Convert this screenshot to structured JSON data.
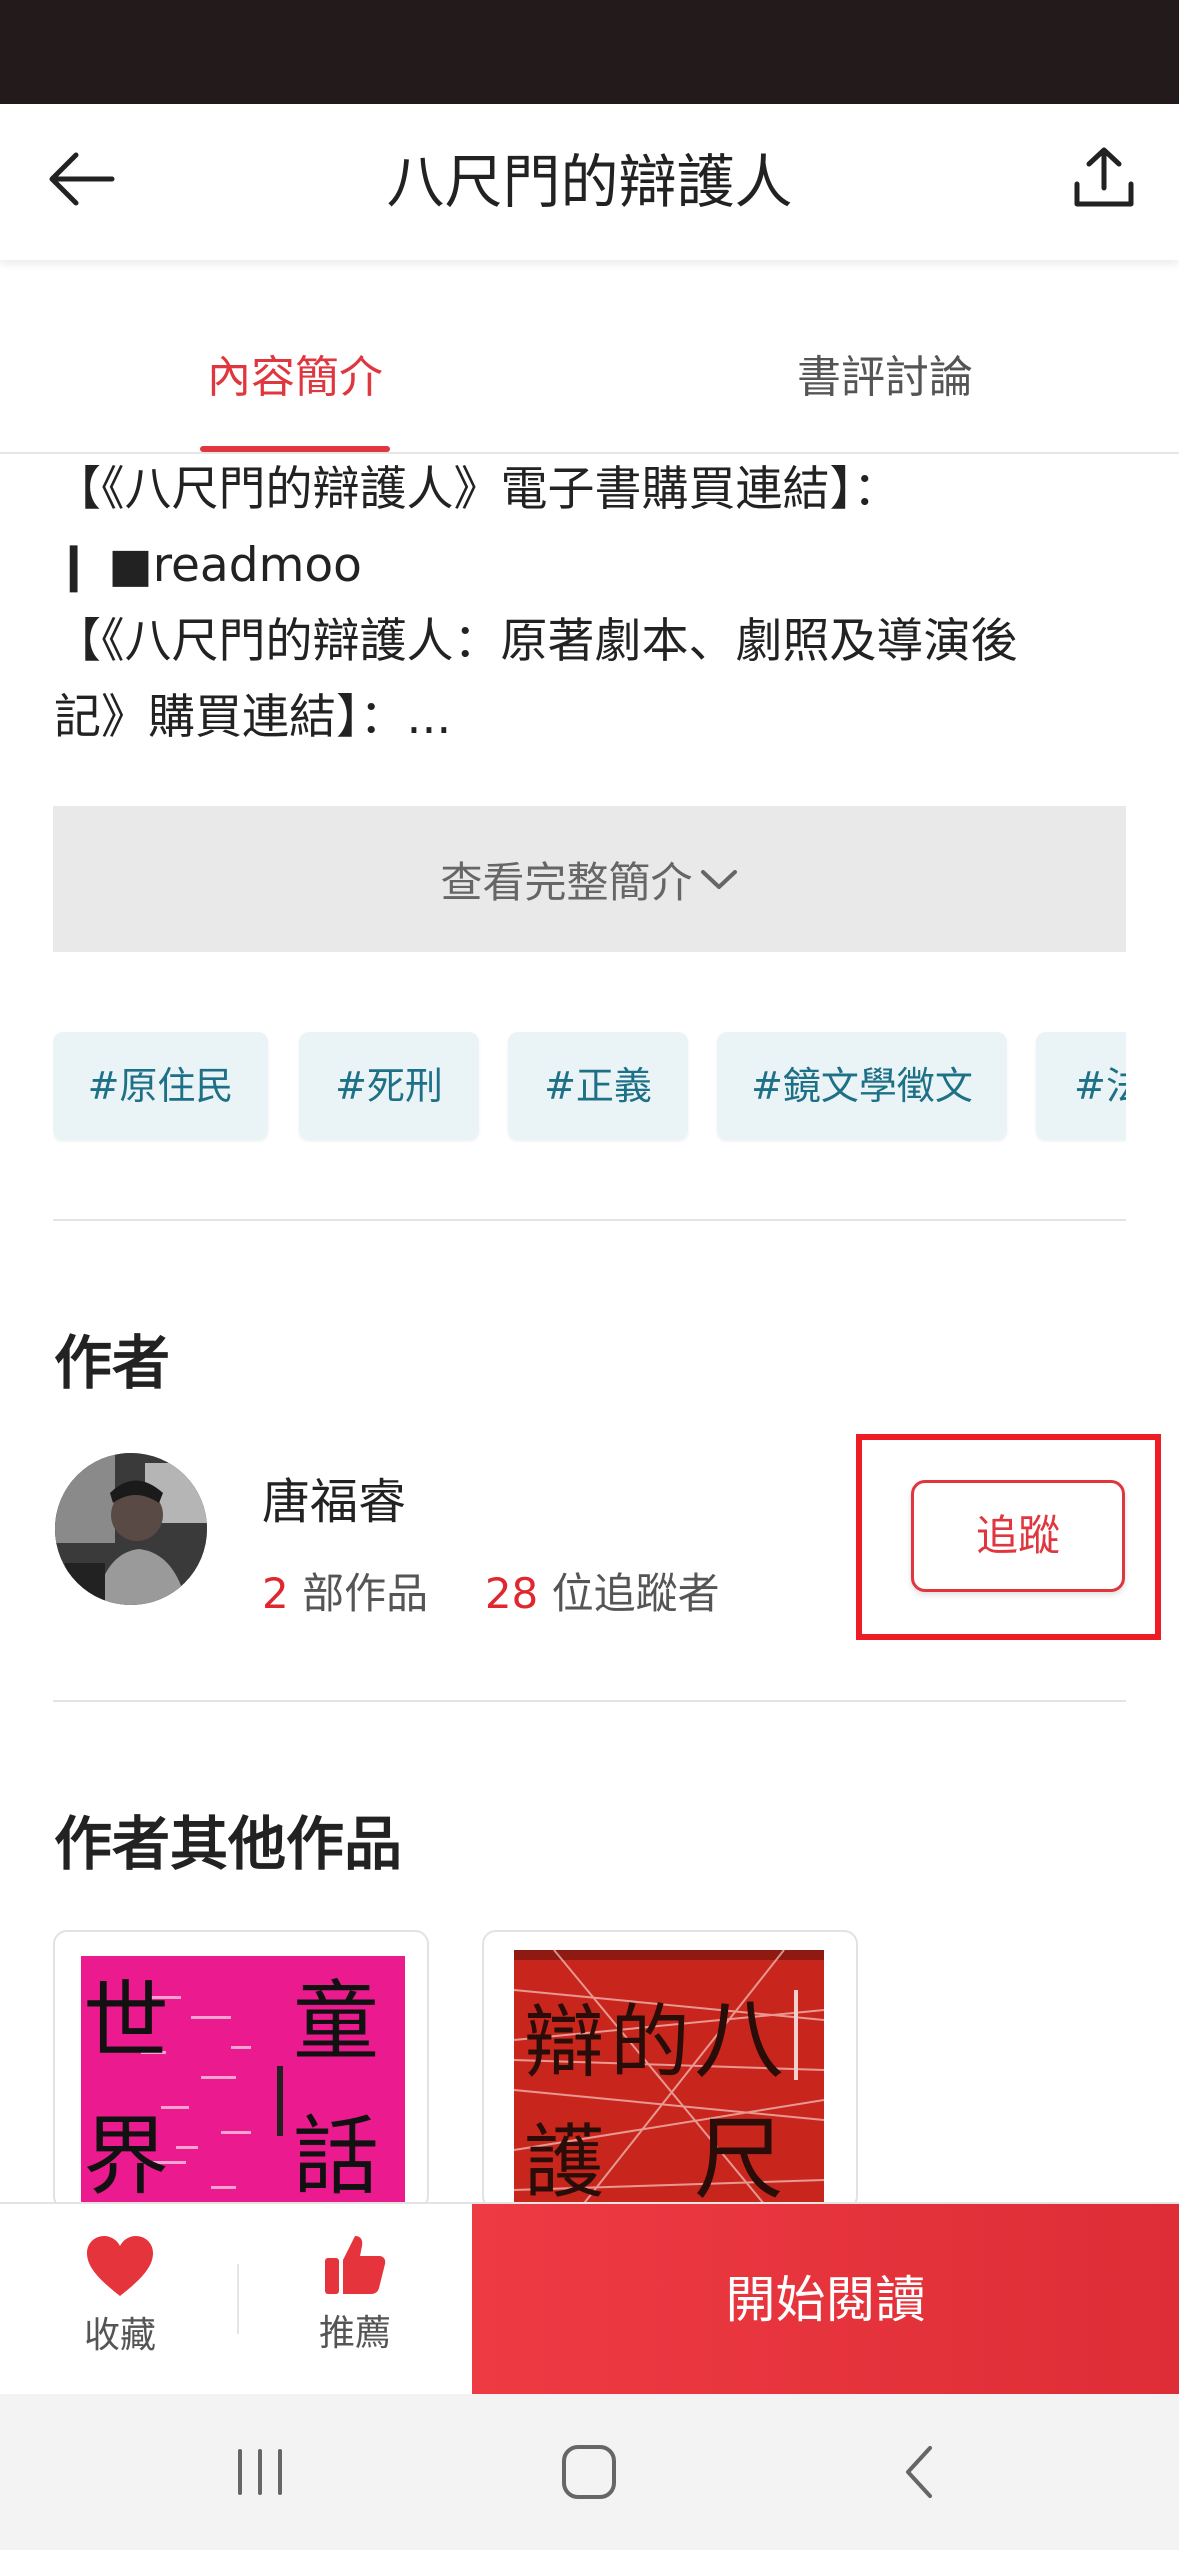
{
  "header": {
    "title": "八尺門的辯護人",
    "back_icon": "arrow-left-icon",
    "share_icon": "share-upload-icon"
  },
  "tabs": [
    {
      "label": "內容簡介",
      "active": true
    },
    {
      "label": "書評討論",
      "active": false
    }
  ],
  "intro": {
    "lines": [
      "【《八尺門的辯護人》電子書購買連結】：",
      "❙ ■readmoo",
      "【《八尺門的辯護人：原著劇本、劇照及導演後",
      "記》購買連結】：..."
    ],
    "expand_label": "查看完整簡介"
  },
  "tags": [
    "#原住民",
    "#死刑",
    "#正義",
    "#鏡文學徵文",
    "#法"
  ],
  "author_section": {
    "title": "作者",
    "name": "唐福睿",
    "works_count": "2",
    "works_label": "部作品",
    "followers_count": "28",
    "followers_label": "位追蹤者",
    "follow_label": "追蹤"
  },
  "other_works": {
    "title": "作者其他作品",
    "books": [
      {
        "cover_text": "世界童話",
        "color": "#ec1a8f"
      },
      {
        "cover_text": "八尺門的辯護人",
        "color": "#c8261c"
      }
    ]
  },
  "bottom_bar": {
    "favorite_label": "收藏",
    "recommend_label": "推薦",
    "read_label": "開始閱讀"
  },
  "colors": {
    "accent": "#e0373f",
    "tag_text": "#1d7086",
    "tag_bg": "#eaf4f6"
  }
}
